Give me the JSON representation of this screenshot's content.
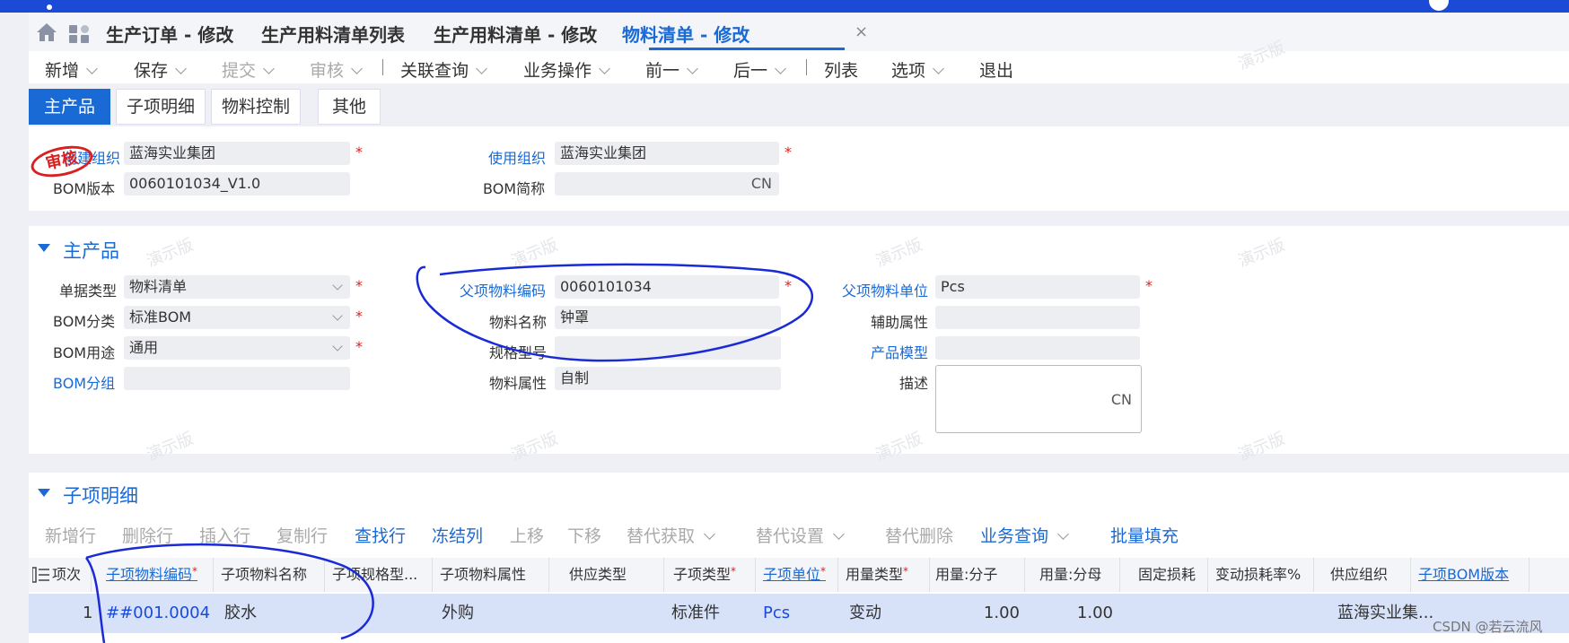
{
  "tabs": [
    {
      "label": "生产订单 - 修改"
    },
    {
      "label": "生产用料清单列表"
    },
    {
      "label": "生产用料清单 - 修改"
    },
    {
      "label": "物料清单 - 修改"
    }
  ],
  "tab_close": "×",
  "toolbar": {
    "new": "新增",
    "save": "保存",
    "submit": "提交",
    "audit": "审核",
    "related": "关联查询",
    "business": "业务操作",
    "prev": "前一",
    "next": "后一",
    "list": "列表",
    "options": "选项",
    "exit": "退出"
  },
  "subtabs": [
    "主产品",
    "子项明细",
    "物料控制",
    "其他"
  ],
  "stamp": "审核",
  "header_form": {
    "create_org_label": "创建组织",
    "create_org_value": "蓝海实业集团",
    "use_org_label": "使用组织",
    "use_org_value": "蓝海实业集团",
    "bom_version_label": "BOM版本",
    "bom_version_value": "0060101034_V1.0",
    "bom_short_label": "BOM简称",
    "bom_short_suffix": "CN",
    "required_mark": "*"
  },
  "main_product": {
    "title": "主产品",
    "doc_type_label": "单据类型",
    "doc_type_value": "物料清单",
    "bom_cat_label": "BOM分类",
    "bom_cat_value": "标准BOM",
    "bom_use_label": "BOM用途",
    "bom_use_value": "通用",
    "bom_group_label": "BOM分组",
    "parent_code_label": "父项物料编码",
    "parent_code_value": "0060101034",
    "material_name_label": "物料名称",
    "material_name_value": "钟罩",
    "spec_label": "规格型号",
    "material_attr_label": "物料属性",
    "material_attr_value": "自制",
    "parent_unit_label": "父项物料单位",
    "parent_unit_value": "Pcs",
    "aux_attr_label": "辅助属性",
    "product_model_label": "产品模型",
    "desc_label": "描述",
    "desc_suffix": "CN"
  },
  "child_section": {
    "title": "子项明细",
    "toolbar": {
      "add_row": "新增行",
      "del_row": "删除行",
      "insert_row": "插入行",
      "copy_row": "复制行",
      "find_row": "查找行",
      "freeze_col": "冻结列",
      "move_up": "上移",
      "move_down": "下移",
      "sub_get": "替代获取",
      "sub_set": "替代设置",
      "sub_del": "替代删除",
      "biz_query": "业务查询",
      "batch_fill": "批量填充"
    },
    "columns": [
      "项次",
      "子项物料编码",
      "子项物料名称",
      "子项规格型...",
      "子项物料属性",
      "供应类型",
      "子项类型",
      "子项单位",
      "用量类型",
      "用量:分子",
      "用量:分母",
      "固定损耗",
      "变动损耗率%",
      "供应组织",
      "子项BOM版本"
    ],
    "rows": [
      {
        "seq": "1",
        "code": "##001.0004",
        "name": "胶水",
        "spec": "",
        "attr": "外购",
        "supply": "",
        "type": "标准件",
        "unit": "Pcs",
        "qty_type": "变动",
        "num": "1.00",
        "den": "1.00",
        "fixed_loss": "",
        "var_loss": "",
        "supply_org": "蓝海实业集...",
        "bom_ver": ""
      }
    ]
  },
  "watermark": "演示版",
  "csdn": "CSDN @若云流风"
}
